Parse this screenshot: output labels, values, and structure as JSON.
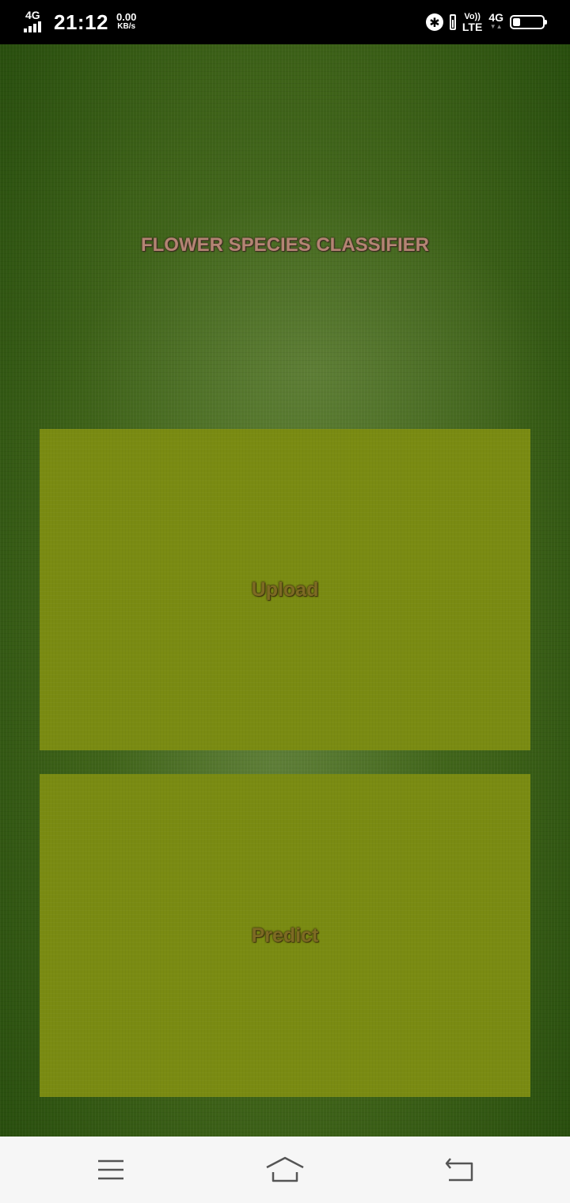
{
  "status_bar": {
    "network_type": "4G",
    "time": "21:12",
    "data_speed_value": "0.00",
    "data_speed_unit": "KB/s",
    "volte_top": "Vo))",
    "volte_bottom": "LTE",
    "network_type_right": "4G",
    "battery_level": "23",
    "icons": [
      "signal-icon",
      "bluetooth-icon",
      "vibrate-icon",
      "volte-icon",
      "battery-icon"
    ]
  },
  "app": {
    "title": "FLOWER SPECIES CLASSIFIER",
    "upload_label": "Upload",
    "predict_label": "Predict",
    "colors": {
      "background": "#3e6219",
      "panel": "#7a8b12",
      "title_text": "#b48474",
      "button_text": "#7d6a23"
    }
  },
  "nav_bar": {
    "icons": [
      "menu-icon",
      "home-icon",
      "back-icon"
    ]
  }
}
